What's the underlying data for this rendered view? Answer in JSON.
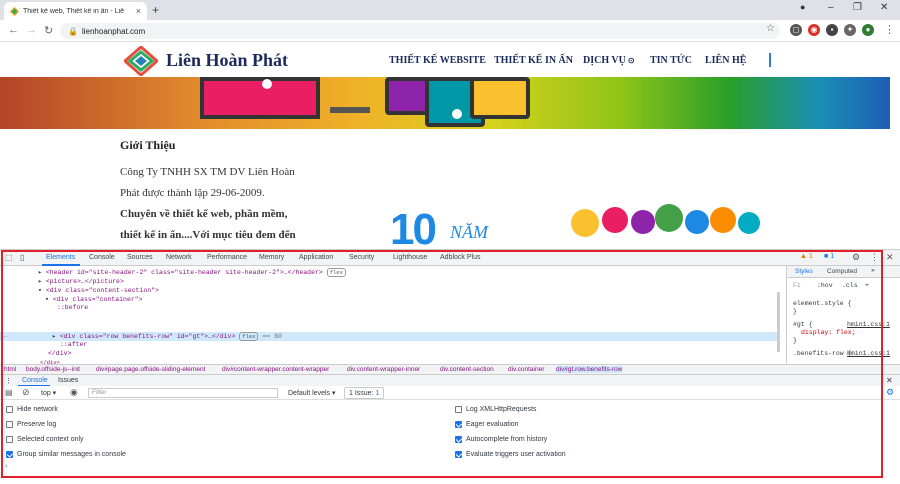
{
  "browser": {
    "tab_title": "Thiết kế web, Thiết kế in ấn - Liê",
    "url": "lienhoanphat.com"
  },
  "site": {
    "logo": "Liên Hoàn Phát",
    "menu": [
      "THIẾT KẾ WEBSITE",
      "THIẾT KẾ IN ẤN",
      "DỊCH VỤ",
      "TIN TỨC",
      "LIÊN HỆ"
    ],
    "intro_title": "Giới Thiệu",
    "intro_lines": [
      "Công Ty TNHH SX TM DV Liên Hoàn",
      "Phát được thành lập 29-06-2009.",
      "Chuyên về thiết kế web, phần mềm,",
      "thiết kế in ấn....Với mục tiêu đem đến"
    ],
    "anniv_num": "10",
    "anniv_word": "NĂM"
  },
  "devtools": {
    "tabs": [
      "Elements",
      "Console",
      "Sources",
      "Network",
      "Performance",
      "Memory",
      "Application",
      "Security",
      "Lighthouse",
      "Adblock Plus"
    ],
    "warn_count": "1",
    "msg_count": "1",
    "dom_lines": [
      {
        "indent": 38,
        "tag": "header",
        "text": "<header id=\"site-header-2\" class=\"site-header site-header-2\">…</header>",
        "badge": "flex"
      },
      {
        "indent": 38,
        "text": "<picture>…</picture>"
      },
      {
        "indent": 38,
        "text": "<div class=\"content-section\">"
      },
      {
        "indent": 45,
        "text": "<div class=\"container\">"
      },
      {
        "indent": 55,
        "text": "::before"
      },
      {
        "indent": 52,
        "text": "<div class=\"row benefits-row\" id=\"gt\">…</div>",
        "badge": "flex",
        "suffix": "== $0"
      },
      {
        "indent": 55,
        "text": "::after"
      },
      {
        "indent": 45,
        "text": "</div>"
      },
      {
        "indent": 38,
        "text": "</div>"
      }
    ],
    "styles_tabs": [
      "Styles",
      "Computed"
    ],
    "styles_filter": "Fi",
    "styles_buttons": [
      ":hov",
      ".cls",
      "+"
    ],
    "styles_rules": [
      {
        "selector": "element.style {",
        "prop": "",
        "close": "}"
      },
      {
        "selector": "#gt {",
        "source": "hmin1.css:1",
        "prop": "display: flex;",
        "close": "}"
      },
      {
        "selector": ".benefits-row {",
        "source": "hmin1.css:1"
      }
    ],
    "breadcrumbs": [
      "html",
      "body.offside-js--init",
      "div#page.page.offside-sliding-element",
      "div#content-wrapper.content-wrapper",
      "div.content-wrapper-inner",
      "div.content-section",
      "div.container",
      "div#gt.row.benefits-row"
    ],
    "drawer_tabs": [
      "Console",
      "Issues"
    ],
    "context": "top",
    "filter_placeholder": "Filter",
    "levels": "Default levels",
    "issues": "1 Issue:",
    "issue_count": "1",
    "settings_left": [
      {
        "label": "Hide network",
        "checked": false
      },
      {
        "label": "Preserve log",
        "checked": false
      },
      {
        "label": "Selected context only",
        "checked": false
      },
      {
        "label": "Group similar messages in console",
        "checked": true
      }
    ],
    "settings_right": [
      {
        "label": "Log XMLHttpRequests",
        "checked": false
      },
      {
        "label": "Eager evaluation",
        "checked": true
      },
      {
        "label": "Autocomplete from history",
        "checked": true
      },
      {
        "label": "Evaluate triggers user activation",
        "checked": true
      }
    ]
  },
  "colors": {
    "highlight": "#e0202a",
    "accent": "#1a73e8"
  }
}
